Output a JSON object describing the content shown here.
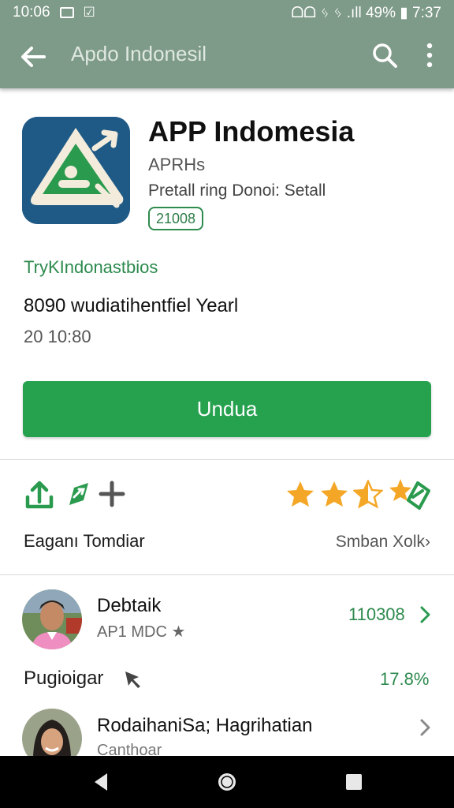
{
  "status_bar": {
    "time": "10:06",
    "left_icons": [
      "image-icon",
      "download-icon"
    ],
    "right_text": "ᗝᗝ ᛃ ᛃ .ıll 49% ▮ 7:37",
    "right_parts": [
      "ᗝᗝ",
      "ᛃ",
      "ᛃ",
      "ıll",
      "49%",
      "7:37"
    ]
  },
  "app_bar": {
    "title": "Apdo Indonesil"
  },
  "app": {
    "name": "APP Indomesia",
    "developer": "APRHs",
    "subtitle": "Pretall ring Donoi: Setall",
    "badge": "21008",
    "icon_colors": {
      "tile": "#1f5a86",
      "triangle": "#f3ecdc",
      "inner": "#2a9a4e"
    }
  },
  "description": {
    "link": "TryKIndonastbios",
    "main": "8090 wudiatihentfiel Yearl",
    "sub": "20 10:80"
  },
  "install_button": {
    "label": "Undua",
    "color": "#26a24f"
  },
  "rating_row": {
    "actions": [
      "share-icon",
      "wishlist-icon",
      "add-icon"
    ],
    "stars": 3.5,
    "left_label": "Eaganı Tomdiar",
    "right_label": "Smban Xolk›"
  },
  "reviews": [
    {
      "name": "Debtaik",
      "subtitle": "AP1 MDC ★",
      "value": "110308"
    },
    {
      "name": "RodaihaniSa; Hagrihatian",
      "subtitle": "Canthoar"
    }
  ],
  "plugin_row": {
    "label": "Pugioigar",
    "percent": "17.8%"
  },
  "colors": {
    "bar": "#7e9a88",
    "accent": "#26a24f",
    "star": "#f4a726"
  }
}
